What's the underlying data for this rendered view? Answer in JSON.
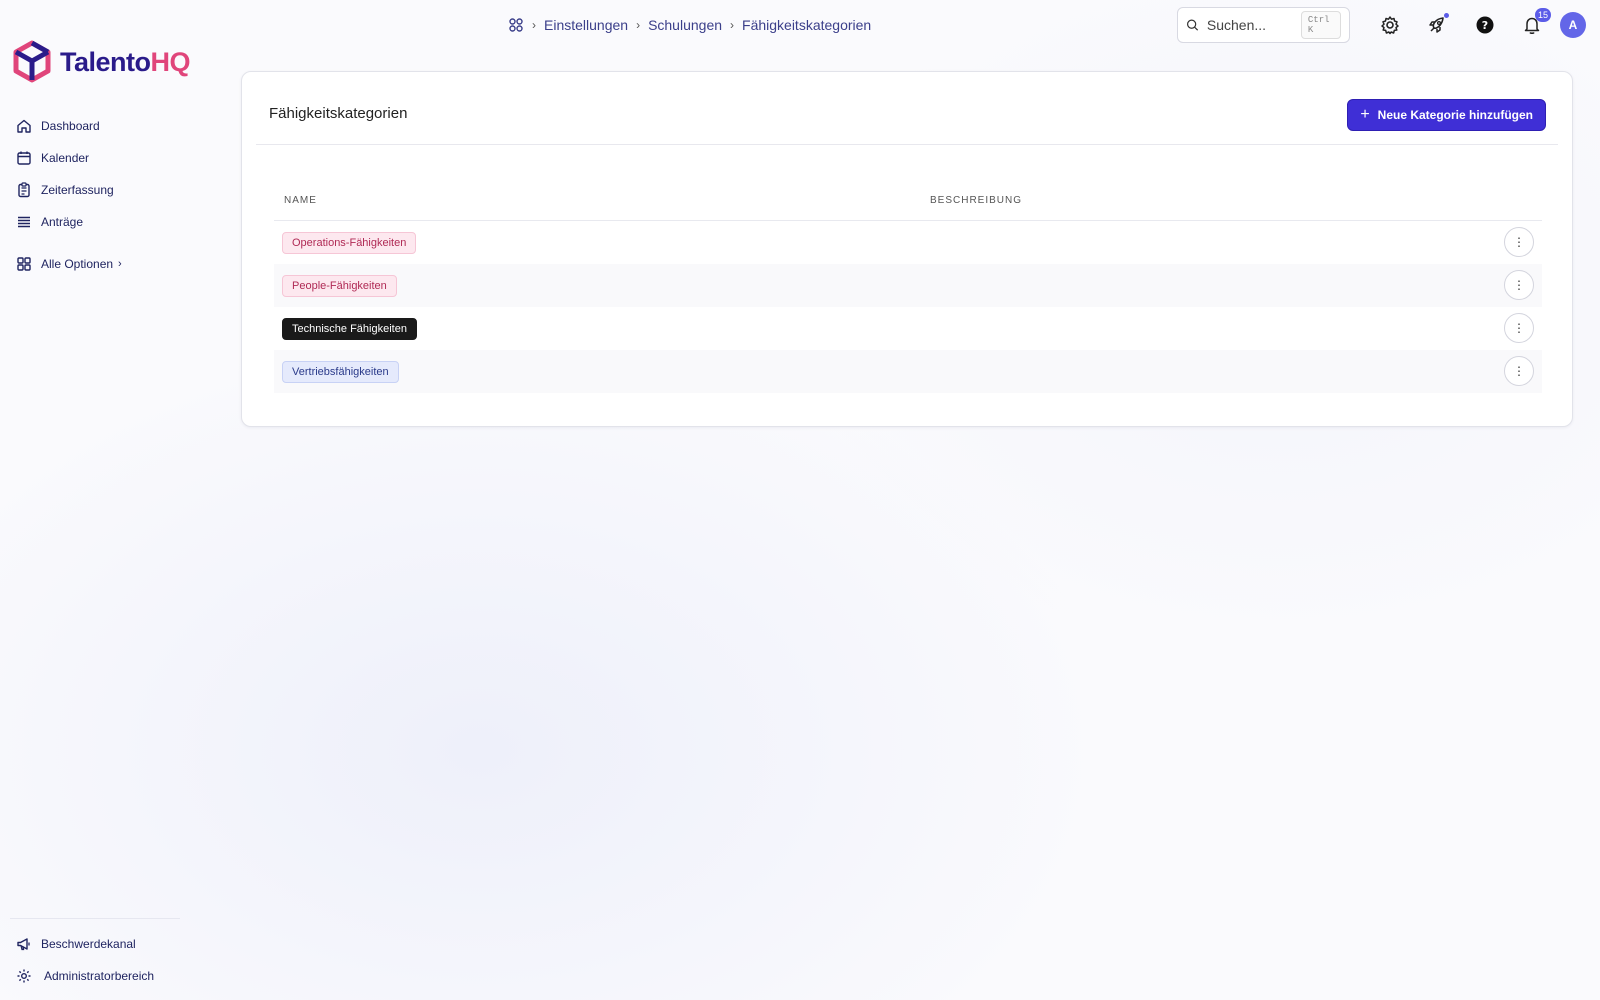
{
  "app": {
    "logo_main": "Talento",
    "logo_accent": "HQ"
  },
  "sidebar": {
    "items": [
      {
        "label": "Dashboard",
        "icon": "home-icon"
      },
      {
        "label": "Kalender",
        "icon": "calendar-icon"
      },
      {
        "label": "Zeiterfassung",
        "icon": "clipboard-icon"
      },
      {
        "label": "Anträge",
        "icon": "stack-icon"
      }
    ],
    "all_options": "Alle Optionen",
    "bottom": [
      {
        "label": "Beschwerdekanal",
        "icon": "megaphone-icon"
      },
      {
        "label": "Administratorbereich",
        "icon": "gear-icon"
      }
    ]
  },
  "breadcrumb": [
    "Einstellungen",
    "Schulungen",
    "Fähigkeitskategorien"
  ],
  "search": {
    "placeholder": "Suchen...",
    "shortcut": "Ctrl K"
  },
  "notifications": {
    "count": "15"
  },
  "user": {
    "initial": "A"
  },
  "page": {
    "title": "Fähigkeitskategorien",
    "add_button": "Neue Kategorie hinzufügen"
  },
  "table": {
    "columns": [
      "NAME",
      "BESCHREIBUNG"
    ],
    "rows": [
      {
        "name": "Operations-Fähigkeiten",
        "description": "",
        "tag_color": "#fde8ef"
      },
      {
        "name": "People-Fähigkeiten",
        "description": "",
        "tag_color": "#fde8ef"
      },
      {
        "name": "Technische Fähigkeiten",
        "description": "",
        "tag_color": "#1a1a1a"
      },
      {
        "name": "Vertriebsfähigkeiten",
        "description": "",
        "tag_color": "#e5eafc"
      }
    ]
  },
  "colors": {
    "primary": "#3f2fd6",
    "brand_dark": "#2a1b8a",
    "brand_accent": "#e0457b",
    "badge": "#5b5ce8"
  }
}
